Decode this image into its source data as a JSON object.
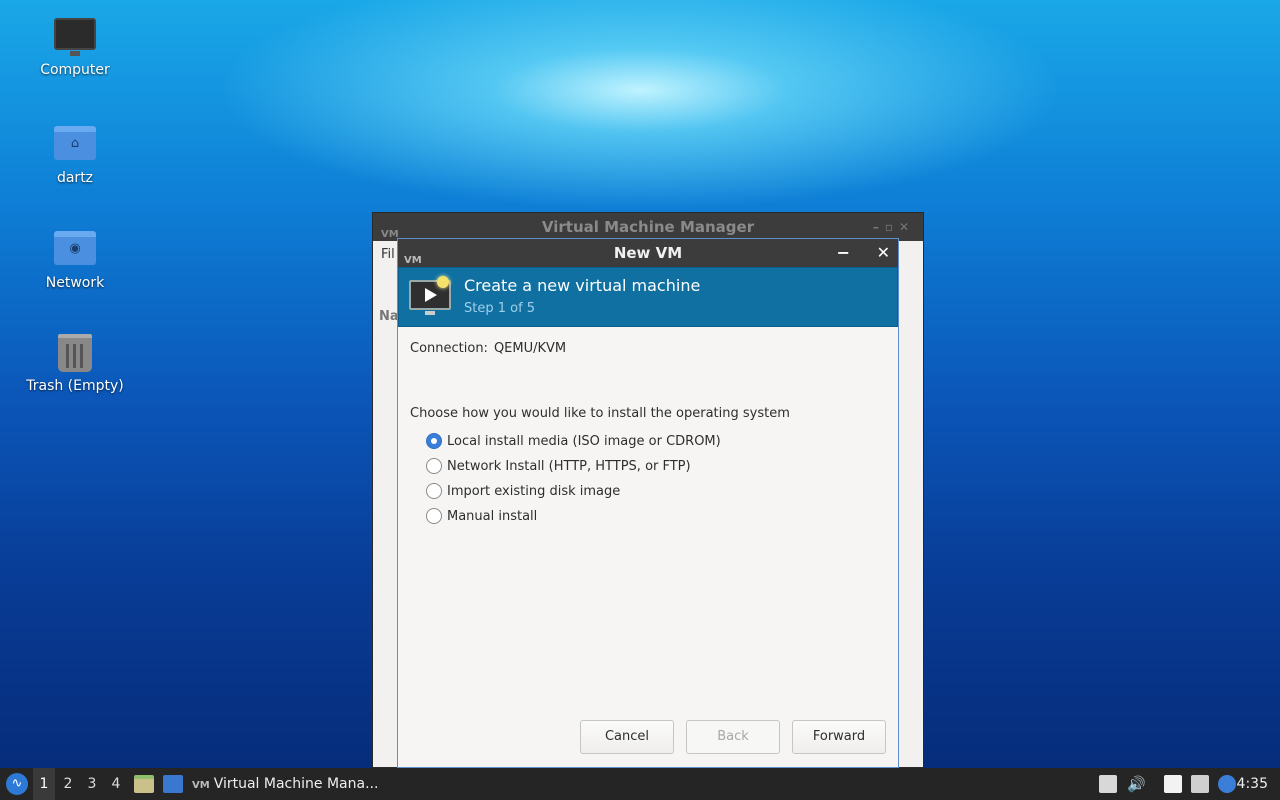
{
  "desktop": {
    "icons": [
      {
        "label": "Computer"
      },
      {
        "label": "dartz"
      },
      {
        "label": "Network"
      },
      {
        "label": "Trash (Empty)"
      }
    ]
  },
  "vmm_window": {
    "title": "Virtual Machine Manager",
    "logo": "VM",
    "menu_first": "Fil",
    "column_head": "Na"
  },
  "new_vm_dialog": {
    "title": "New VM",
    "logo": "VM",
    "banner_title": "Create a new virtual machine",
    "banner_step": "Step 1 of 5",
    "connection_label": "Connection:",
    "connection_value": "QEMU/KVM",
    "choose_label": "Choose how you would like to install the operating system",
    "options": [
      {
        "label": "Local install media (ISO image or CDROM)",
        "selected": true
      },
      {
        "label": "Network Install (HTTP, HTTPS, or FTP)",
        "selected": false
      },
      {
        "label": "Import existing disk image",
        "selected": false
      },
      {
        "label": "Manual install",
        "selected": false
      }
    ],
    "buttons": {
      "cancel": "Cancel",
      "back": "Back",
      "forward": "Forward"
    },
    "min_glyph": "−",
    "close_glyph": "✕"
  },
  "taskbar": {
    "start_glyph": "∿",
    "workspaces": [
      "1",
      "2",
      "3",
      "4"
    ],
    "active_workspace": "1",
    "task_logo": "VM",
    "task_label": "Virtual Machine Mana...",
    "clock": "4:35"
  },
  "colors": {
    "banner": "#0f70a1",
    "accent": "#3a7ed8",
    "titlebar": "#3c3c3c",
    "taskbar": "#252525"
  }
}
